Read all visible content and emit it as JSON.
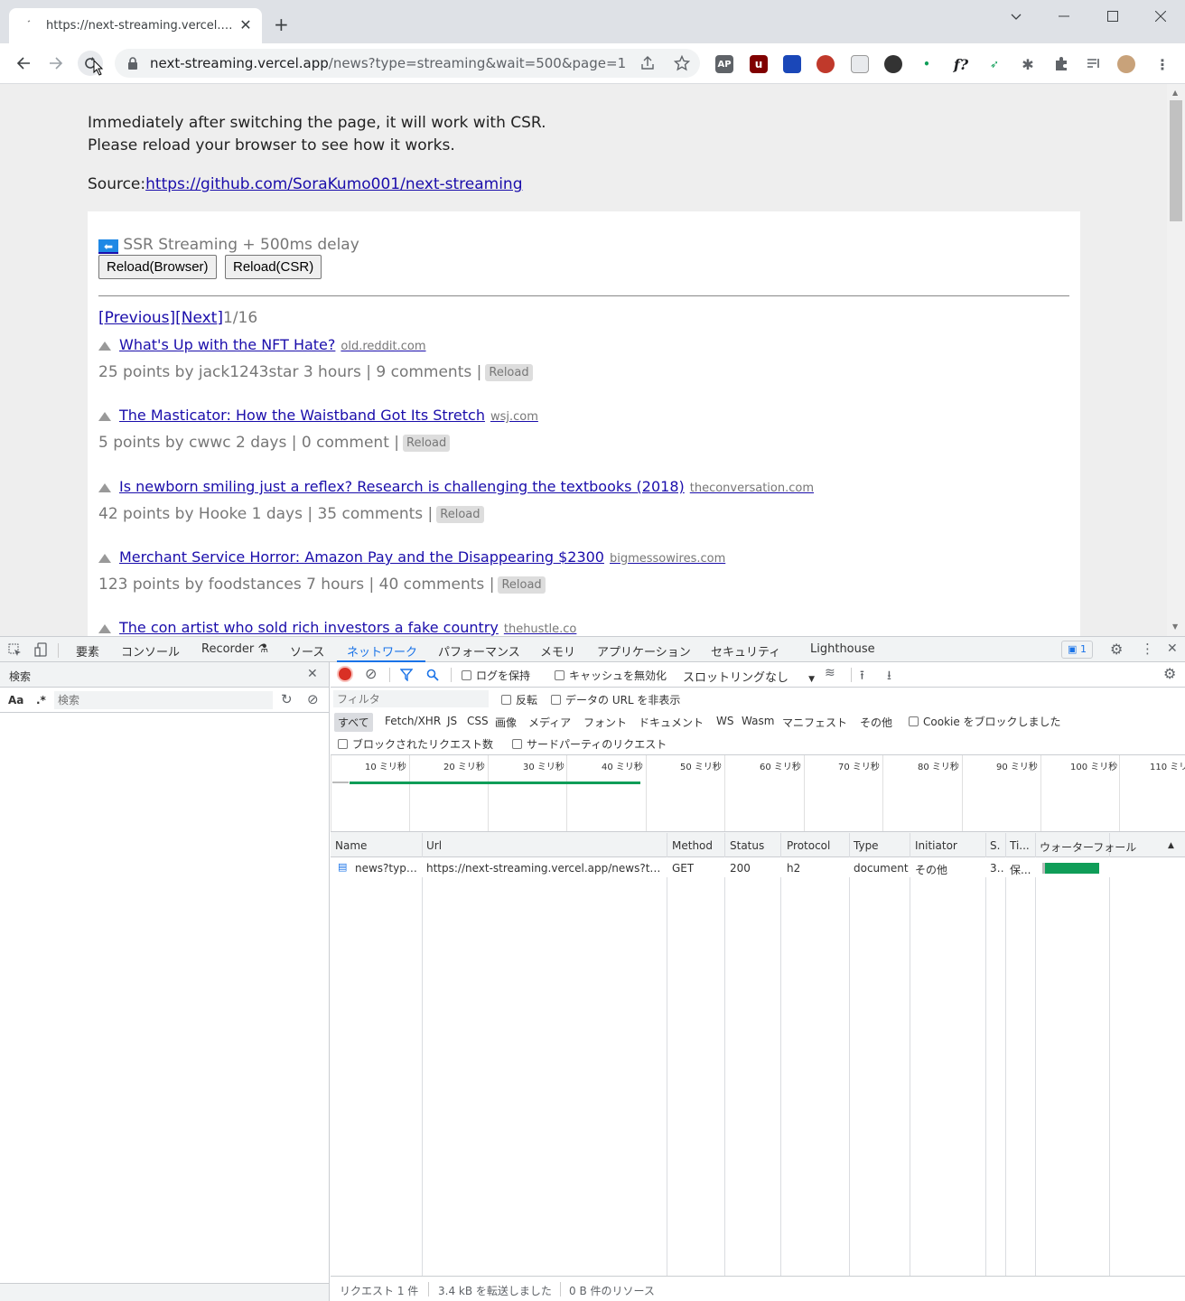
{
  "browser": {
    "tab_title": "https://next-streaming.vercel.app",
    "url_host": "next-streaming.vercel.app",
    "url_path": "/news?type=streaming&wait=500&page=1"
  },
  "page": {
    "intro_line1": "Immediately after switching the page, it will work with CSR.",
    "intro_line2": "Please reload your browser to see how it works.",
    "source_label": "Source:",
    "source_link": "https://github.com/SoraKumo001/next-streaming",
    "mode_text": "SSR Streaming + 500ms delay",
    "reload_browser": "Reload(Browser)",
    "reload_csr": "Reload(CSR)",
    "prev": "[Previous]",
    "next": "[Next]",
    "page_count": "1/16",
    "items": [
      {
        "title": "What's Up with the NFT Hate?",
        "domain": "old.reddit.com",
        "meta": "25 points by jack1243star 3 hours | 9 comments |",
        "reload": "Reload"
      },
      {
        "title": "The Masticator: How the Waistband Got Its Stretch",
        "domain": "wsj.com",
        "meta": "5 points by cwwc 2 days | 0 comment |",
        "reload": "Reload"
      },
      {
        "title": "Is newborn smiling just a reflex? Research is challenging the textbooks (2018)",
        "domain": "theconversation.com",
        "meta": "42 points by Hooke 1 days | 35 comments |",
        "reload": "Reload"
      },
      {
        "title": "Merchant Service Horror: Amazon Pay and the Disappearing $2300",
        "domain": "bigmessowires.com",
        "meta": "123 points by foodstances 7 hours | 40 comments |",
        "reload": "Reload"
      },
      {
        "title": "The con artist who sold rich investors a fake country",
        "domain": "thehustle.co",
        "meta": "",
        "reload": ""
      }
    ]
  },
  "devtools": {
    "tabs": [
      "要素",
      "コンソール",
      "Recorder",
      "ソース",
      "ネットワーク",
      "パフォーマンス",
      "メモリ",
      "アプリケーション",
      "セキュリティ",
      "Lighthouse"
    ],
    "issues_count": "1",
    "search_title": "検索",
    "search_case": "Aa",
    "search_regex": ".*",
    "search_placeholder": "検索",
    "preserve_log": "ログを保持",
    "disable_cache": "キャッシュを無効化",
    "throttling": "スロットリングなし",
    "filter_placeholder": "フィルタ",
    "invert": "反転",
    "hide_data_url": "データの URL を非表示",
    "types": [
      "すべて",
      "Fetch/XHR",
      "JS",
      "CSS",
      "画像",
      "メディア",
      "フォント",
      "ドキュメント",
      "WS",
      "Wasm",
      "マニフェスト",
      "その他"
    ],
    "blocked_cookies": "Cookie をブロックしました",
    "blocked_requests": "ブロックされたリクエスト数",
    "third_party": "サードパーティのリクエスト",
    "ticks": [
      "10 ミリ秒",
      "20 ミリ秒",
      "30 ミリ秒",
      "40 ミリ秒",
      "50 ミリ秒",
      "60 ミリ秒",
      "70 ミリ秒",
      "80 ミリ秒",
      "90 ミリ秒",
      "100 ミリ秒",
      "110 ミリ"
    ],
    "columns": [
      "Name",
      "Url",
      "Method",
      "Status",
      "Protocol",
      "Type",
      "Initiator",
      "S.",
      "Ti...",
      "ウォーターフォール"
    ],
    "row": {
      "name": "news?type...",
      "url": "https://next-streaming.vercel.app/news?type...",
      "method": "GET",
      "status": "200",
      "protocol": "h2",
      "type": "document",
      "initiator": "その他",
      "size": "3...",
      "time": "保..."
    },
    "status_requests": "リクエスト 1 件",
    "status_transferred": "3.4 kB を転送しました",
    "status_resources": "0 B 件のリソース"
  },
  "colors": {
    "accent": "#1a73e8",
    "record": "#d93025",
    "waterfall": "#0f9d58"
  }
}
